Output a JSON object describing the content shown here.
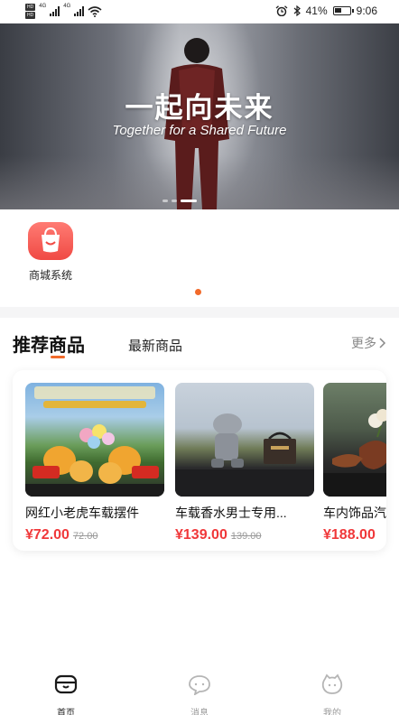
{
  "status_bar": {
    "sim1": "HD",
    "sim2": "HD",
    "network": "4G",
    "battery": "41%",
    "battery_level": 0.41,
    "time": "9:06"
  },
  "banner": {
    "title": "一起向未来",
    "subtitle": "Together for a Shared Future",
    "slide_count": 3,
    "active_slide": 2
  },
  "quick_entry": {
    "label": "商城系统",
    "icon": "shopping-bag-icon"
  },
  "tabs": {
    "active": "推荐商品",
    "inactive": "最新商品",
    "more": "更多"
  },
  "products": [
    {
      "name": "网红小老虎车载摆件",
      "price": "¥72.00",
      "original": "72.00"
    },
    {
      "name": "车载香水男士专用...",
      "price": "¥139.00",
      "original": "139.00"
    },
    {
      "name": "车内饰品汽车",
      "price": "¥188.00",
      "original": ""
    }
  ],
  "tabbar": {
    "items": [
      {
        "label": "首页",
        "icon": "home-icon",
        "active": true
      },
      {
        "label": "消息",
        "icon": "message-icon",
        "active": false
      },
      {
        "label": "我的",
        "icon": "profile-icon",
        "active": false
      }
    ]
  },
  "colors": {
    "accent": "#f26a2a",
    "price": "#f0383a",
    "entry_icon": "#f04a44"
  }
}
